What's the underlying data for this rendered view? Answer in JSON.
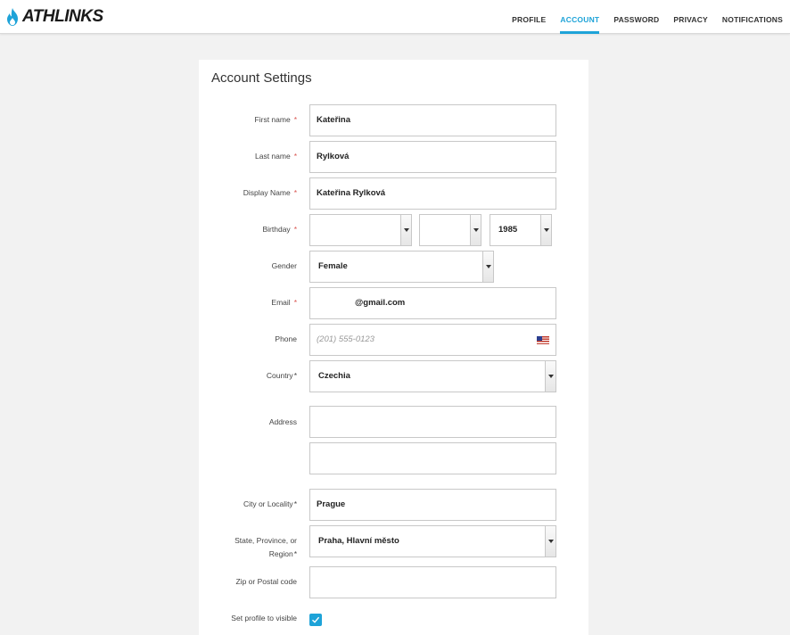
{
  "header": {
    "logo_text": "ATHLINKS",
    "nav": [
      {
        "label": "PROFILE"
      },
      {
        "label": "ACCOUNT"
      },
      {
        "label": "PASSWORD"
      },
      {
        "label": "PRIVACY"
      },
      {
        "label": "NOTIFICATIONS"
      }
    ],
    "active_tab": "ACCOUNT",
    "accent_color": "#1ea3d8"
  },
  "form": {
    "title": "Account Settings",
    "first_name": {
      "label": "First name",
      "required_mark": "*",
      "value": "Kateřina"
    },
    "last_name": {
      "label": "Last name",
      "required_mark": "*",
      "value": "Rylková"
    },
    "display_name": {
      "label": "Display Name",
      "required_mark": "*",
      "value": "Kateřina Rylková"
    },
    "birthday": {
      "label": "Birthday",
      "required_mark": "*",
      "month": "",
      "day": "",
      "year": "1985"
    },
    "gender": {
      "label": "Gender",
      "value": "Female"
    },
    "email": {
      "label": "Email",
      "required_mark": "*",
      "value": "@gmail.com"
    },
    "phone": {
      "label": "Phone",
      "placeholder": "(201) 555-0123",
      "flag_icon": "us-flag-icon"
    },
    "country": {
      "label": "Country",
      "required_mark": "*",
      "value": "Czechia"
    },
    "address": {
      "label": "Address",
      "line1": "",
      "line2": ""
    },
    "city": {
      "label": "City or Locality",
      "required_mark": "*",
      "value": "Prague"
    },
    "state": {
      "label_line1": "State, Province, or",
      "label_line2": "Region",
      "required_mark": "*",
      "value": "Praha, Hlavní město"
    },
    "zip": {
      "label": "Zip or Postal code",
      "value": ""
    },
    "visible": {
      "label": "Set profile to visible",
      "checked": true
    }
  }
}
